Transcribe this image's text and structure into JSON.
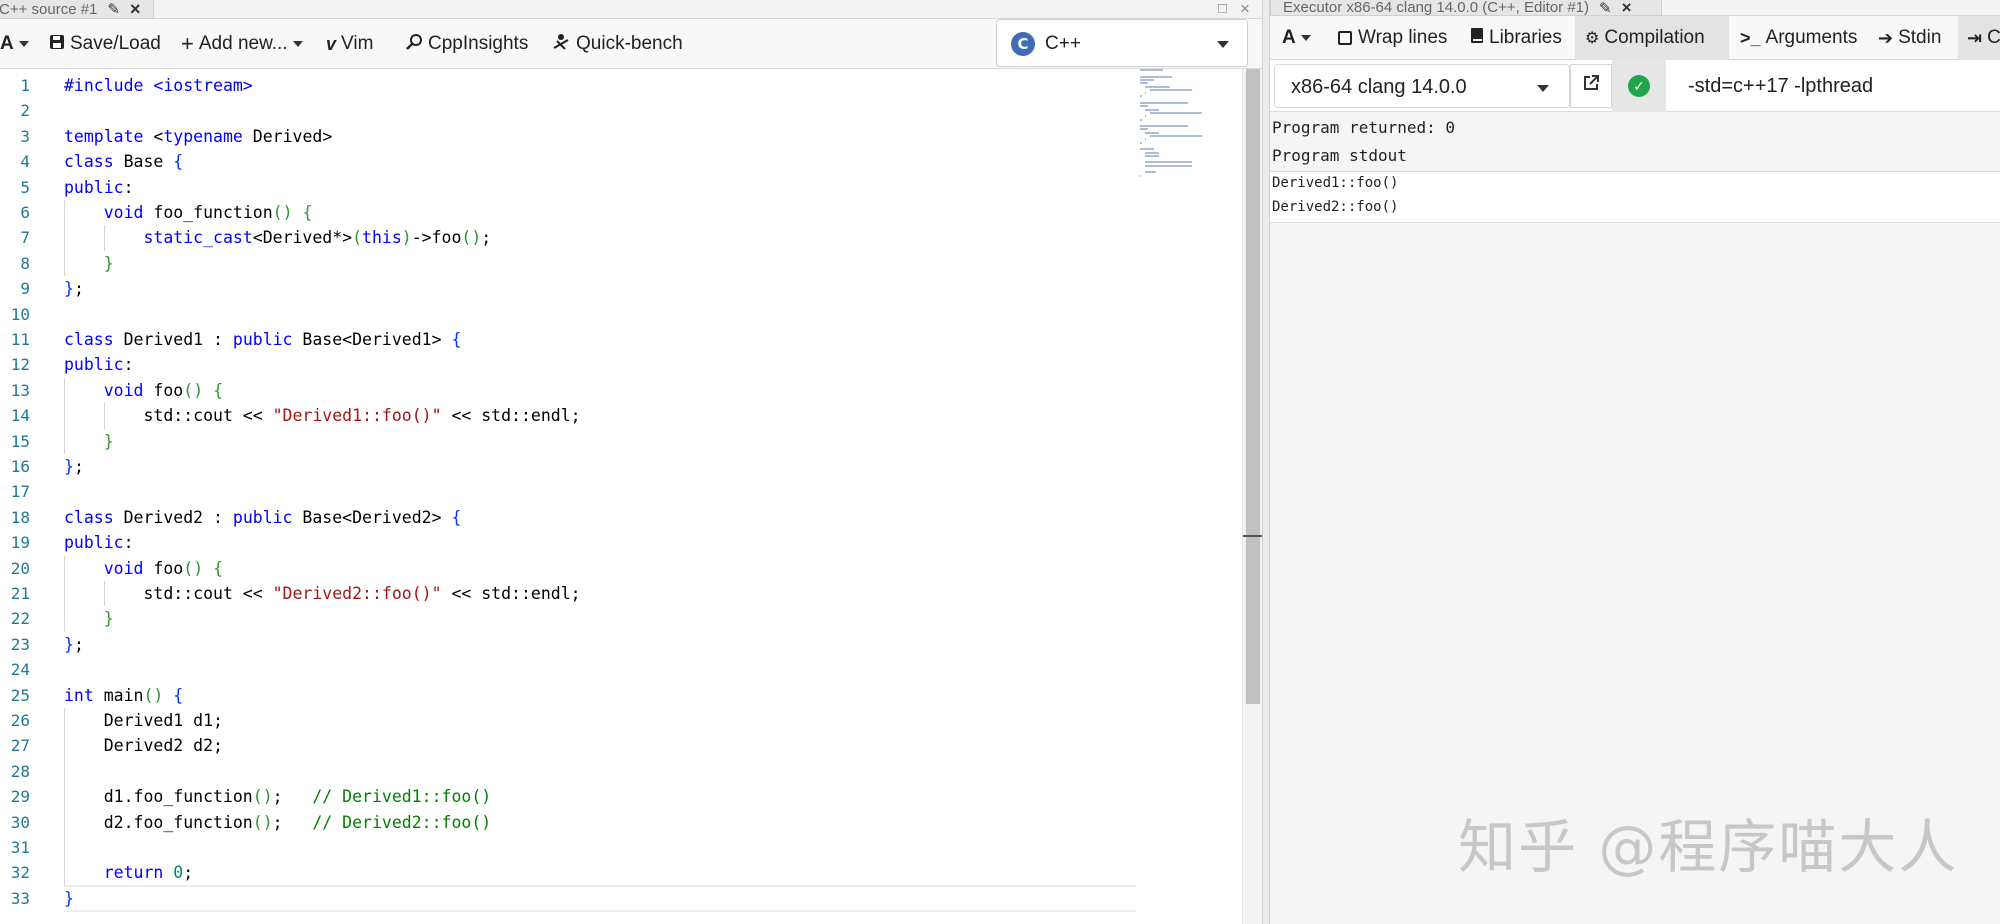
{
  "left_tab": {
    "title": "C++ source #1"
  },
  "left_toolbar": {
    "font_btn": "A",
    "save_load": "Save/Load",
    "add_new": "Add new...",
    "vim": "Vim",
    "cppinsights": "CppInsights",
    "quick_bench": "Quick-bench",
    "language": "C++"
  },
  "code_lines": [
    "#include <iostream>",
    "",
    "template <typename Derived>",
    "class Base {",
    "public:",
    "    void foo_function() {",
    "        static_cast<Derived*>(this)->foo();",
    "    }",
    "};",
    "",
    "class Derived1 : public Base<Derived1> {",
    "public:",
    "    void foo() {",
    "        std::cout << \"Derived1::foo()\" << std::endl;",
    "    }",
    "};",
    "",
    "class Derived2 : public Base<Derived2> {",
    "public:",
    "    void foo() {",
    "        std::cout << \"Derived2::foo()\" << std::endl;",
    "    }",
    "};",
    "",
    "int main() {",
    "    Derived1 d1;",
    "    Derived2 d2;",
    "",
    "    d1.foo_function();   // Derived1::foo()",
    "    d2.foo_function();   // Derived2::foo()",
    "",
    "    return 0;",
    "}"
  ],
  "right_tab": {
    "title": "Executor x86-64 clang 14.0.0 (C++, Editor #1)"
  },
  "right_toolbar": {
    "font_btn": "A",
    "wrap_lines": "Wrap lines",
    "libraries": "Libraries",
    "compilation": "Compilation",
    "arguments": "Arguments",
    "stdin": "Stdin",
    "cut_item": "C"
  },
  "compiler": {
    "name": "x86-64 clang 14.0.0",
    "flags": "-std=c++17 -lpthread",
    "status": "success"
  },
  "output": {
    "returned": "Program returned: 0",
    "stdout_label": "Program stdout",
    "stdout_lines": [
      "Derived1::foo()",
      "Derived2::foo()"
    ]
  },
  "watermark": "知乎 @程序喵大人",
  "colors": {
    "keyword": "#0000ff",
    "string": "#a31515",
    "comment": "#008000",
    "number": "#098658",
    "line_number": "#237893",
    "success": "#1fa64a"
  },
  "icons": {
    "save": "floppy-disk-icon",
    "add": "plus-icon",
    "vim": "vim-icon",
    "cppinsights": "magnifier-icon",
    "quick_bench": "bench-icon",
    "wrap": "checkbox-icon",
    "libraries": "book-icon",
    "compilation": "gears-icon",
    "arguments": "terminal-icon",
    "stdin": "sign-in-icon",
    "popout": "external-link-icon",
    "status": "check-circle-icon"
  }
}
